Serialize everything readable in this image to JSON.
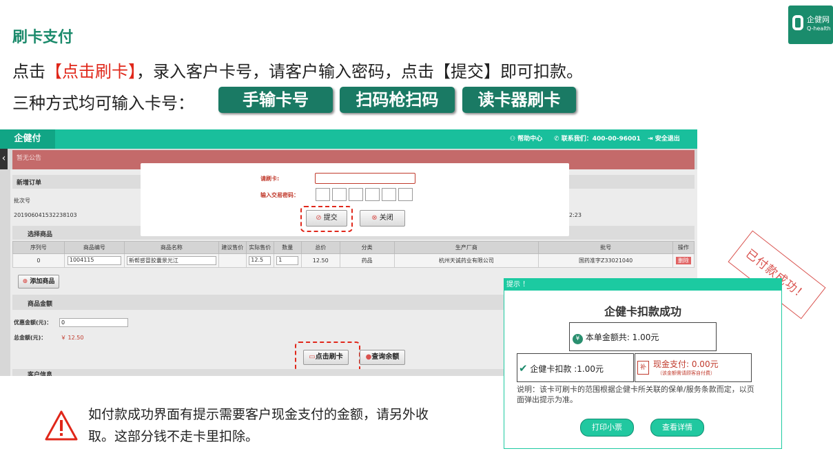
{
  "logo": {
    "line1": "企健网",
    "line2": "Q-health"
  },
  "slide": {
    "title": "刷卡支付",
    "instruction_pre": "点击",
    "instruction_highlight": "【点击刷卡】",
    "instruction_post": "，录入客户卡号，请客户输入密码，点击【提交】即可扣款。",
    "methods_label": "三种方式均可输入卡号：",
    "methods": [
      "手输卡号",
      "扫码枪扫码",
      "读卡器刷卡"
    ],
    "warning": "如付款成功界面有提示需要客户现金支付的金额，请另外收取。这部分钱不走卡里扣除。"
  },
  "app": {
    "brand": "企健付",
    "help": "帮助中心",
    "contact": "联系我们：400-00-96001",
    "logout": "安全退出",
    "notice": "暂无公告",
    "new_order": "新增订单",
    "batch_label": "批次号",
    "batch_value": "201906041532238103",
    "time_tail": "2:23",
    "select_goods": "选择商品",
    "table": {
      "headers": [
        "序列号",
        "商品编号",
        "商品名称",
        "建议售价",
        "实际售价",
        "数量",
        "总价",
        "分类",
        "生产厂商",
        "批号",
        "操作"
      ],
      "row": {
        "seq": "0",
        "code": "1004115",
        "name": "新帮感冒胶囊景光江",
        "suggested": "",
        "actual": "12.5",
        "qty": "1",
        "total": "12.50",
        "category": "药品",
        "maker": "杭州天诚药业有限公司",
        "batch": "国药准字Z33021040",
        "op": "删除"
      }
    },
    "add_goods": "添加商品",
    "goods_amount": "商品金额",
    "discount_label": "优惠金额(元)：",
    "discount_value": "0",
    "total_label": "总金额(元)：",
    "total_value": "￥ 12.50",
    "swipe_btn": "点击刷卡",
    "balance_btn": "查询余额",
    "customer_info": "客户信息"
  },
  "modal": {
    "card_label": "请刷卡:",
    "pwd_label": "输入交易密码：",
    "submit": "提交",
    "close": "关闭"
  },
  "popup": {
    "bar": "提示 ！",
    "title": "企健卡扣款成功",
    "amount": "本单金额共: 1.00元",
    "card_pay": "企健卡扣款 :1.00元",
    "cash_pay": "现金支付: 0.00元",
    "cash_note": "（该金额需请顾客自付费）",
    "note": "说明：该卡可刷卡的范围根据企健卡所关联的保单/服务条款而定，以页面弹出提示为准。",
    "print": "打印小票",
    "detail": "查看详情"
  },
  "stamp": "已付款成功！",
  "colors": {
    "brand": "#19bf9c",
    "title": "#1b8a6b",
    "accent_red": "#e0271a",
    "method_btn": "#1a7a64"
  }
}
